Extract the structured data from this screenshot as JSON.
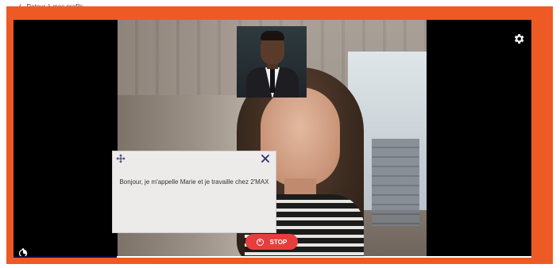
{
  "header": {
    "back_label": "Retour à mes profils"
  },
  "dialog": {
    "text": "Bonjour, je m'appelle Marie et je travaille chez 2'MAX"
  },
  "controls": {
    "stop_label": "STOP"
  },
  "progress": {
    "fraction": 0.2
  },
  "icons": {
    "back": "chevron-left-icon",
    "settings": "gear-icon",
    "move": "move-icon",
    "close": "close-icon",
    "stop": "stop-circle-icon",
    "timer": "timer-icon"
  },
  "colors": {
    "frame": "#ee5a24",
    "stop_button": "#e63d3d",
    "progress_fill": "#0c0b4a",
    "dialog_icons": "#2a2f6b"
  }
}
